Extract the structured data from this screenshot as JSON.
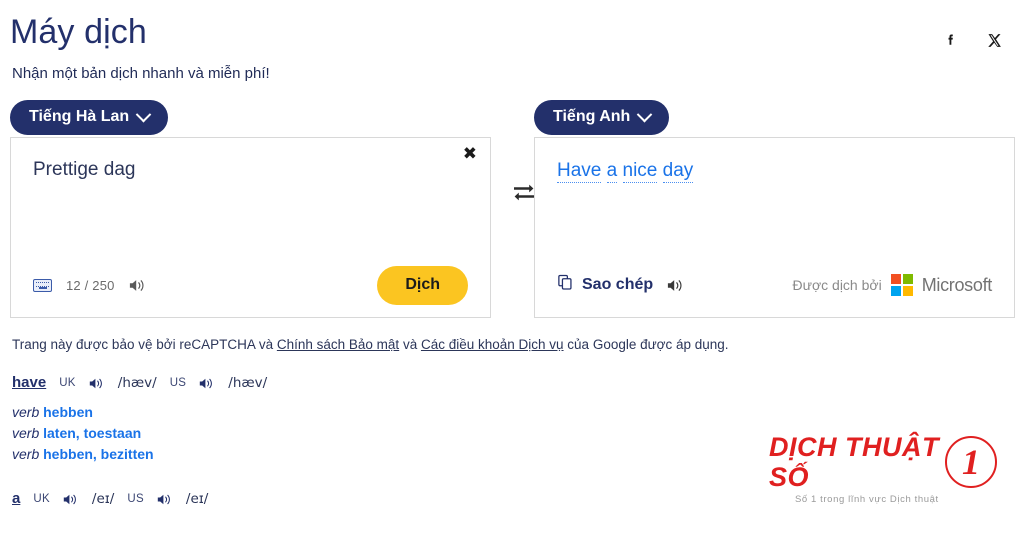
{
  "header": {
    "title": "Máy dịch",
    "subtitle": "Nhận một bản dịch nhanh và miễn phí!",
    "social": [
      {
        "name": "facebook-icon",
        "label": "f"
      },
      {
        "name": "x-twitter-icon",
        "label": "X"
      }
    ]
  },
  "translator": {
    "source": {
      "language": "Tiếng Hà Lan",
      "text": "Prettige dag",
      "counter": "12 / 250",
      "clear_label": "✖",
      "translate_button": "Dịch",
      "keyboard_icon": "keyboard-icon",
      "speak_icon": "speaker-icon"
    },
    "target": {
      "language": "Tiếng Anh",
      "words": [
        "Have",
        "a",
        "nice",
        "day"
      ],
      "copy_label": "Sao chép",
      "copy_icon": "copy-icon",
      "speak_icon": "speaker-icon",
      "credit_text": "Được dịch bởi",
      "credit_brand": "Microsoft"
    },
    "swap_icon": "swap-arrows-icon"
  },
  "recaptcha": {
    "part1": "Trang này được bảo vệ bởi reCAPTCHA và ",
    "link1": "Chính sách Bảo mật",
    "part2": " và ",
    "link2": "Các điều khoản Dịch vụ",
    "part3": " của Google được áp dụng."
  },
  "dictionary": [
    {
      "word": "have",
      "uk_label": "UK",
      "uk_ipa": "/hæv/",
      "us_label": "US",
      "us_ipa": "/hæv/",
      "senses": [
        {
          "pos": "verb",
          "gloss": "hebben"
        },
        {
          "pos": "verb",
          "gloss": "laten, toestaan"
        },
        {
          "pos": "verb",
          "gloss": "hebben, bezitten"
        }
      ]
    },
    {
      "word": "a",
      "uk_label": "UK",
      "uk_ipa": "/eɪ/",
      "us_label": "US",
      "us_ipa": "/eɪ/",
      "senses": []
    }
  ],
  "brand": {
    "name": "DỊCH THUẬT SỐ",
    "mark": "1",
    "tagline": "Số 1 trong lĩnh vực Dịch thuật"
  },
  "colors": {
    "navy": "#23306b",
    "accent_yellow": "#fbc521",
    "link_blue": "#1a73e8",
    "brand_red": "#e02020",
    "ms_red": "#f25022",
    "ms_green": "#7fba00",
    "ms_blue": "#00a4ef",
    "ms_yellow": "#ffb900"
  }
}
